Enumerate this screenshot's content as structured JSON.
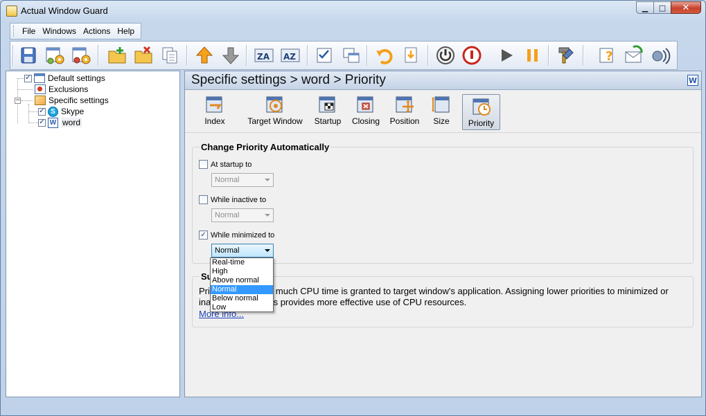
{
  "window": {
    "title": "Actual Window Guard"
  },
  "caption_buttons": {
    "minimize": "▁",
    "maximize": "□",
    "close": "✕"
  },
  "menu": [
    "File",
    "Windows",
    "Actions",
    "Help"
  ],
  "tree": {
    "default": {
      "label": "Default settings",
      "checked": true
    },
    "exclusions": {
      "label": "Exclusions"
    },
    "specific": {
      "label": "Specific settings",
      "expand": "−"
    },
    "skype": {
      "label": "Skype",
      "checked": true
    },
    "word": {
      "label": "word",
      "checked": true
    }
  },
  "header": {
    "title": "Specific settings > word > Priority",
    "app_icon_letter": "W"
  },
  "tabs": [
    "Index",
    "Target Window",
    "Startup",
    "Closing",
    "Position",
    "Size",
    "Priority"
  ],
  "selected_tab": "Priority",
  "priority_group": {
    "title": "Change Priority Automatically",
    "startup": {
      "label": "At startup to",
      "checked": false,
      "value": "Normal"
    },
    "inactive": {
      "label": "While inactive to",
      "checked": false,
      "value": "Normal"
    },
    "minimized": {
      "label": "While minimized to",
      "checked": true,
      "value": "Normal"
    }
  },
  "dropdown": {
    "options": [
      "Real-time",
      "High",
      "Above normal",
      "Normal",
      "Below normal",
      "Low"
    ],
    "selected": "Normal"
  },
  "summary": {
    "title_visible": "Su",
    "line1_start": "Pri",
    "line1_end": "w much CPU time is granted to target window's application. Assigning lower priorities to minimized or",
    "line2_start": "ina",
    "line2_end": "ns provides more effective use of CPU resources.",
    "more_info": "More info..."
  },
  "colors": {
    "accent": "#3399ff",
    "link": "#1a3fb5",
    "close_red": "#c7422c"
  }
}
